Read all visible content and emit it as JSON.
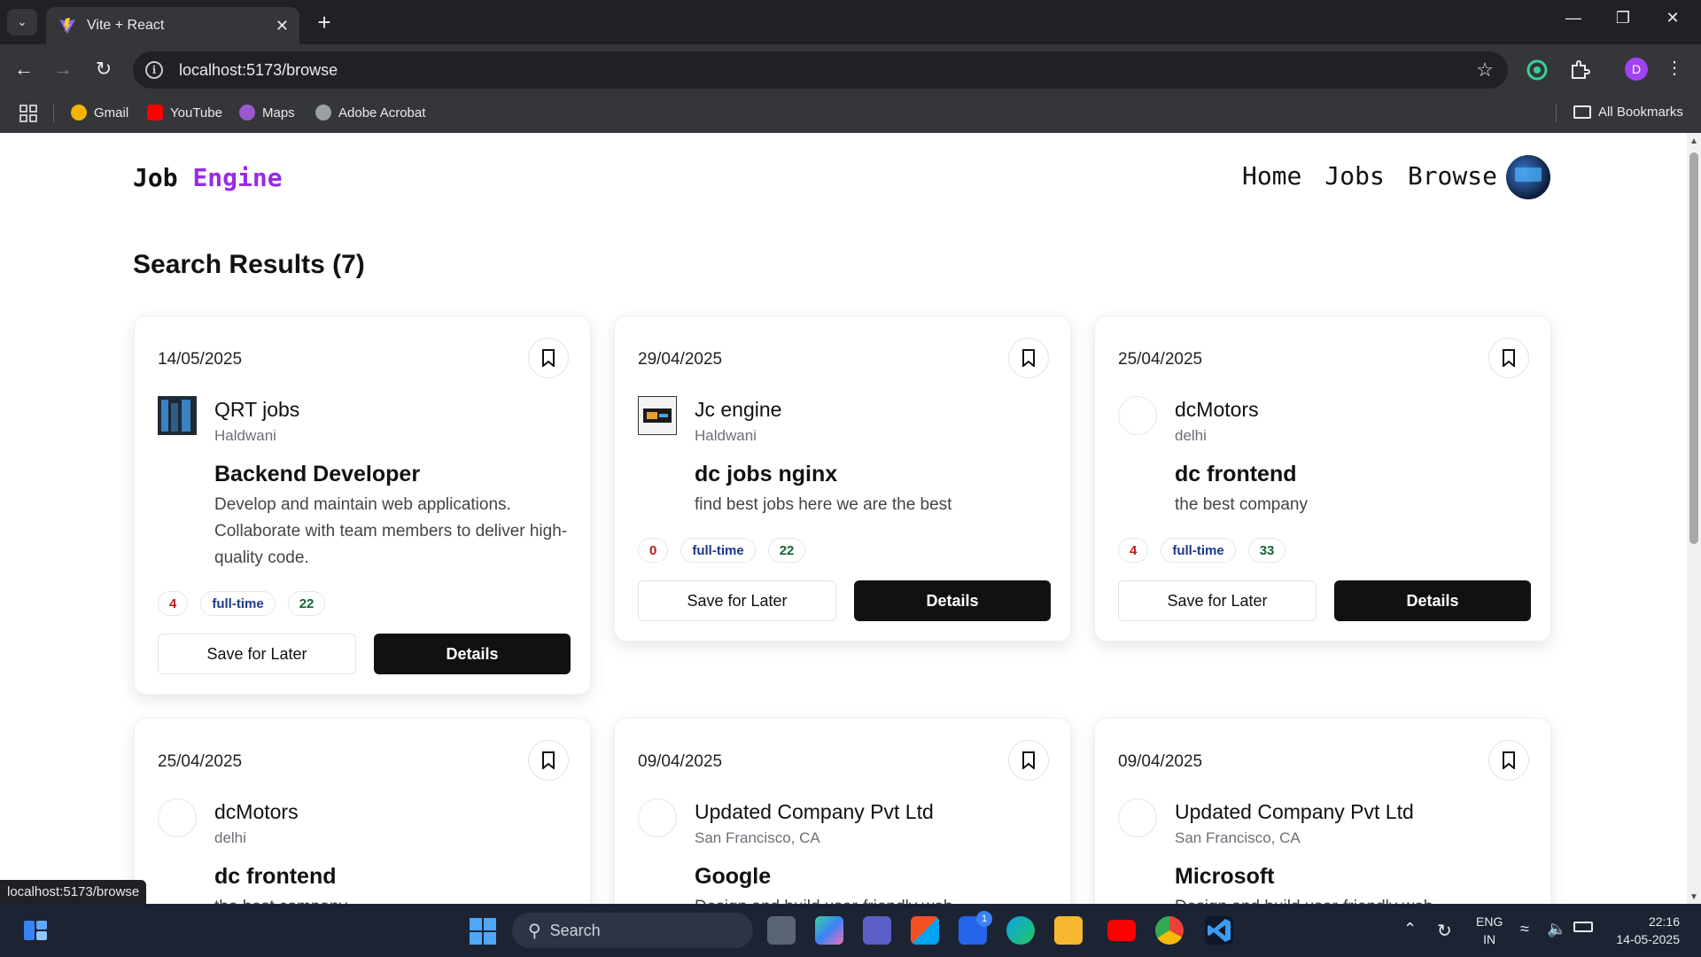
{
  "browser": {
    "tab_title": "Vite + React",
    "url": "localhost:5173/browse",
    "bookmarks": [
      {
        "label": "Gmail"
      },
      {
        "label": "YouTube"
      },
      {
        "label": "Maps"
      },
      {
        "label": "Adobe Acrobat"
      }
    ],
    "all_bookmarks": "All Bookmarks",
    "profile_initial": "D",
    "status_url": "localhost:5173/browse"
  },
  "page": {
    "logo_part1": "Job",
    "logo_part2": "Engine",
    "nav": [
      "Home",
      "Jobs",
      "Browse"
    ],
    "results_title": "Search Results (7)",
    "save_label": "Save for Later",
    "details_label": "Details",
    "jobs": [
      {
        "date": "14/05/2025",
        "company": "QRT jobs",
        "location": "Haldwani",
        "title": "Backend Developer",
        "description": "Develop and maintain web applications. Collaborate with team members to deliver high-quality code.",
        "positions": "4",
        "type": "full-time",
        "salary": "22"
      },
      {
        "date": "29/04/2025",
        "company": "Jc engine",
        "location": "Haldwani",
        "title": "dc jobs nginx",
        "description": "find best jobs here we are the best",
        "positions": "0",
        "type": "full-time",
        "salary": "22"
      },
      {
        "date": "25/04/2025",
        "company": "dcMotors",
        "location": "delhi",
        "title": "dc frontend",
        "description": "the best company",
        "positions": "4",
        "type": "full-time",
        "salary": "33"
      },
      {
        "date": "25/04/2025",
        "company": "dcMotors",
        "location": "delhi",
        "title": "dc frontend",
        "description": "the best company"
      },
      {
        "date": "09/04/2025",
        "company": "Updated Company Pvt Ltd",
        "location": "San Francisco, CA",
        "title": "Google",
        "description": "Design and build user-friendly web"
      },
      {
        "date": "09/04/2025",
        "company": "Updated Company Pvt Ltd",
        "location": "San Francisco, CA",
        "title": "Microsoft",
        "description": "Design and build user-friendly web"
      }
    ]
  },
  "taskbar": {
    "search_placeholder": "Search",
    "notification_count": "1",
    "language": "ENG",
    "region": "IN",
    "time": "22:16",
    "date": "14-05-2025"
  }
}
